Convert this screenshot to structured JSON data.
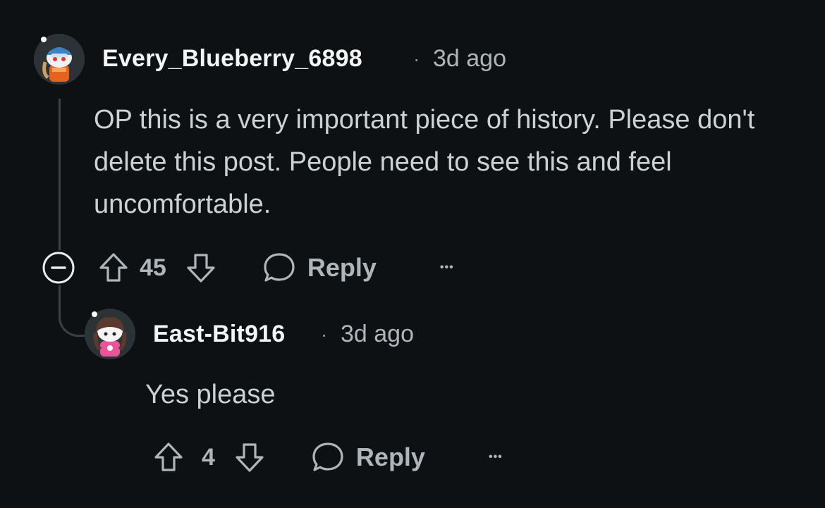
{
  "comments": [
    {
      "username": "Every_Blueberry_6898",
      "separator": "·",
      "time": "3d ago",
      "text": "OP this is a very important piece of history. Please don't delete this post. People need to see this and feel uncomfortable.",
      "votes": "45",
      "reply_label": "Reply",
      "more_label": "•••",
      "avatar_icon": "snoo-avatar-helmet-icon"
    },
    {
      "username": "East-Bit916",
      "separator": "·",
      "time": "3d ago",
      "text": "Yes please",
      "votes": "4",
      "reply_label": "Reply",
      "more_label": "•••",
      "avatar_icon": "snoo-avatar-bunny-shirt-icon"
    }
  ],
  "colors": {
    "background": "#0e1113",
    "username": "#f2f4f5",
    "text": "#cbd2d6",
    "muted": "#aeb6bb",
    "thread_line": "#3a4145"
  }
}
